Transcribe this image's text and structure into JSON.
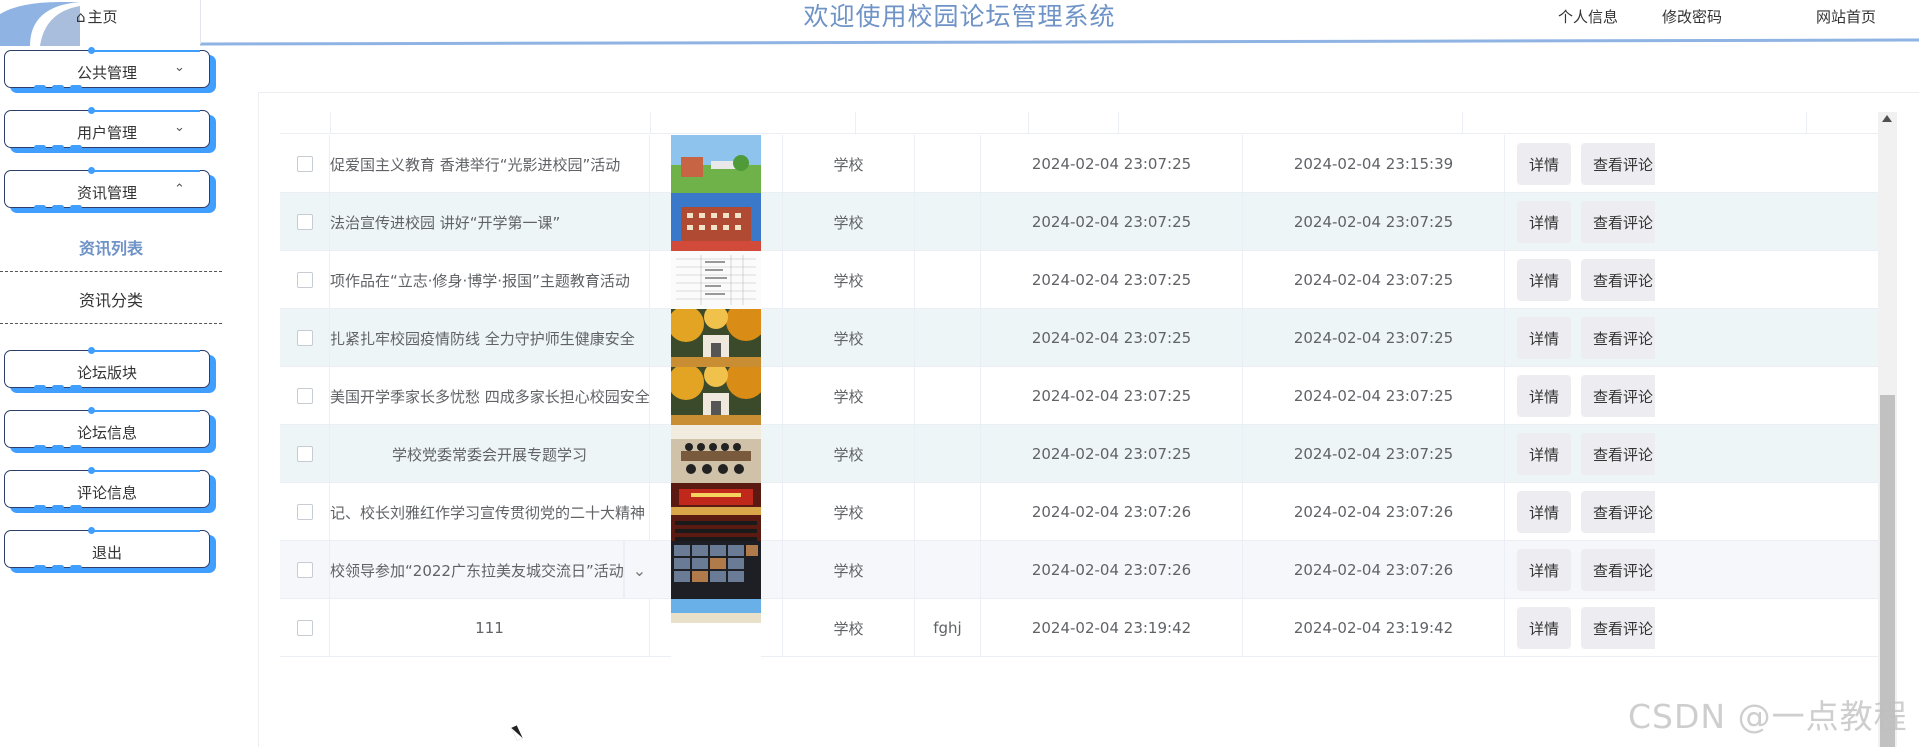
{
  "header": {
    "home_label": "主页",
    "title": "欢迎使用校园论坛管理系统",
    "nav": [
      "个人信息",
      "修改密码",
      "网站首页"
    ]
  },
  "sidebar": {
    "menus": [
      {
        "label": "公共管理",
        "chevron": "chevron-down"
      },
      {
        "label": "用户管理",
        "chevron": "chevron-down"
      },
      {
        "label": "资讯管理",
        "chevron": "chevron-up"
      }
    ],
    "submenu": [
      {
        "label": "资讯列表",
        "active": true
      },
      {
        "label": "资讯分类",
        "active": false
      }
    ],
    "menus2": [
      {
        "label": "论坛版块"
      },
      {
        "label": "论坛信息"
      },
      {
        "label": "评论信息"
      },
      {
        "label": "退出"
      }
    ]
  },
  "table": {
    "detail_label": "详情",
    "comments_label": "查看评论",
    "rows": [
      {
        "title": "促爱国主义教育 香港举行“光影进校园”活动",
        "category": "学校",
        "extra": "",
        "created": "2024-02-04 23:07:25",
        "updated": "2024-02-04 23:15:39",
        "thumb": "campus-lawn"
      },
      {
        "title": "法治宣传进校园 讲好“开学第一课”",
        "category": "学校",
        "extra": "",
        "created": "2024-02-04 23:07:25",
        "updated": "2024-02-04 23:07:25",
        "thumb": "red-building"
      },
      {
        "title": "项作品在“立志·修身·博学·报国”主题教育活动",
        "category": "学校",
        "extra": "",
        "created": "2024-02-04 23:07:25",
        "updated": "2024-02-04 23:07:25",
        "thumb": "document-table"
      },
      {
        "title": "扎紧扎牢校园疫情防线 全力守护师生健康安全",
        "category": "学校",
        "extra": "",
        "created": "2024-02-04 23:07:25",
        "updated": "2024-02-04 23:07:25",
        "thumb": "autumn-gate"
      },
      {
        "title": "美国开学季家长多忧愁 四成多家长担心校园安全",
        "category": "学校",
        "extra": "",
        "created": "2024-02-04 23:07:25",
        "updated": "2024-02-04 23:07:25",
        "thumb": "autumn-gate"
      },
      {
        "title": "学校党委常委会开展专题学习",
        "category": "学校",
        "extra": "",
        "created": "2024-02-04 23:07:25",
        "updated": "2024-02-04 23:07:25",
        "thumb": "meeting-room"
      },
      {
        "title": "记、校长刘雅红作学习宣传贯彻党的二十大精神",
        "category": "学校",
        "extra": "",
        "created": "2024-02-04 23:07:26",
        "updated": "2024-02-04 23:07:26",
        "thumb": "auditorium"
      },
      {
        "title": "校领导参加“2022广东拉美友城交流日”活动",
        "category": "学校",
        "extra": "",
        "created": "2024-02-04 23:07:26",
        "updated": "2024-02-04 23:07:26",
        "thumb": "video-conference"
      },
      {
        "title": "111",
        "category": "学校",
        "extra": "fghj",
        "created": "2024-02-04 23:19:42",
        "updated": "2024-02-04 23:19:42",
        "thumb": "sky-campus"
      }
    ]
  },
  "watermark": "CSDN @一点教程",
  "colors": {
    "accent": "#409eff",
    "title": "#6f93c7",
    "stripe": "#eef5f7"
  }
}
